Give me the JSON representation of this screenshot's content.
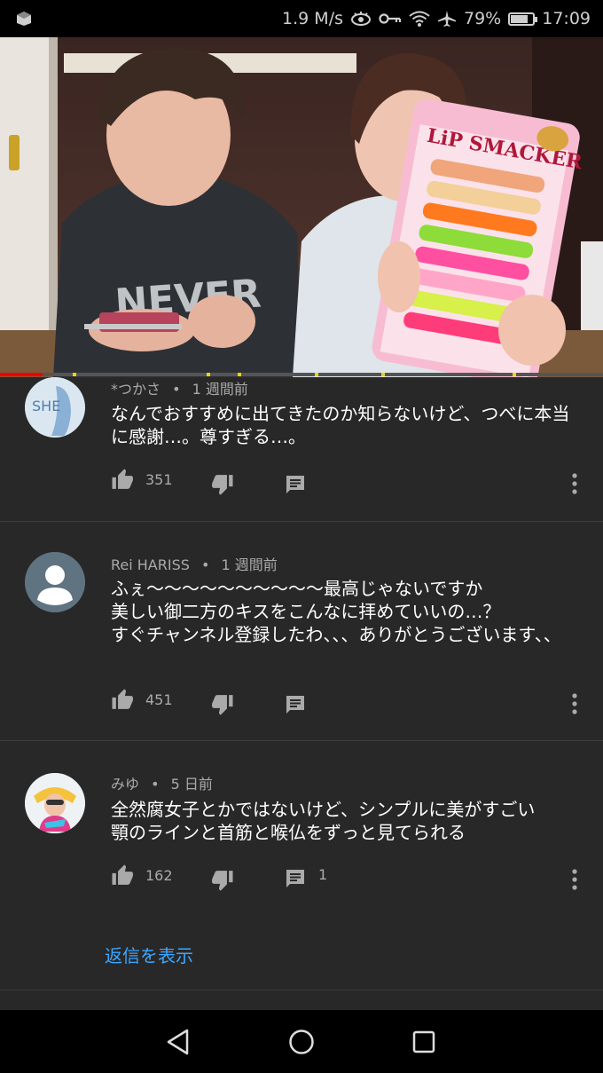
{
  "status_bar": {
    "speed": "1.9 M/s",
    "battery": "79%",
    "battery_level": 0.79,
    "time": "17:09"
  },
  "video": {
    "product_text": "LiP SMACKER",
    "shirt_text": "NEVER",
    "progress": 0.07,
    "colors": {
      "played": "#ee0000",
      "marker": "#f2d400"
    }
  },
  "comments": [
    {
      "author": "*つかさ",
      "separator": "•",
      "time": "1 週間前",
      "text": "なんでおすすめに出てきたのか知らないけど、つべに本当に感謝…。尊すぎる…。",
      "likes": "351",
      "replies": "",
      "avatar_text": "SHE"
    },
    {
      "author": "Rei HARISS",
      "separator": "•",
      "time": "1 週間前",
      "text": "ふぇ〜〜〜〜〜〜〜〜〜〜最高じゃないですか\n美しい御二方のキスをこんなに拝めていいの…？\nすぐチャンネル登録したわ、、、ありがとうございます、、",
      "likes": "451",
      "replies": ""
    },
    {
      "author": "みゆ",
      "separator": "•",
      "time": "5 日前",
      "text": "全然腐女子とかではないけど、シンプルに美がすごい\n顎のラインと首筋と喉仏をずっと見てられる",
      "likes": "162",
      "replies": "1"
    }
  ],
  "show_replies_label": "返信を表示",
  "icons": {
    "like": "thumbs-up-icon",
    "dislike": "thumbs-down-icon",
    "reply": "comment-icon",
    "more": "more-vert-icon"
  }
}
